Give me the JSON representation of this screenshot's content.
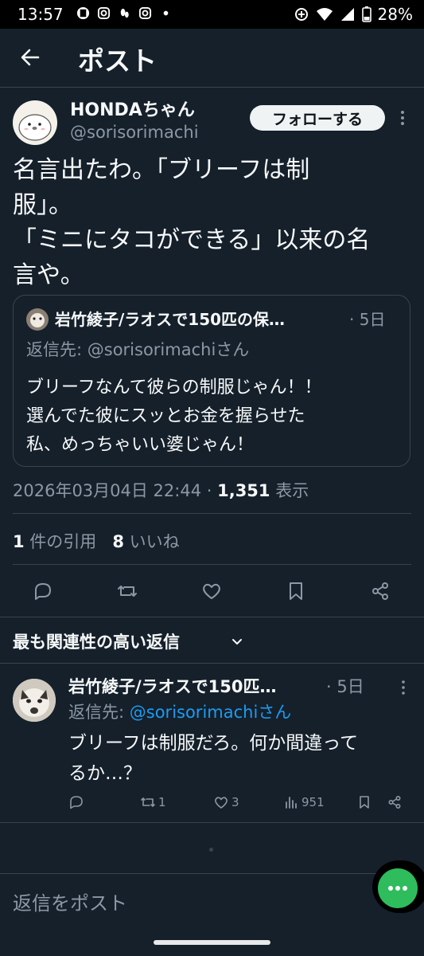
{
  "status_bar": {
    "time": "13:57",
    "battery": "28%"
  },
  "header": {
    "title": "ポスト"
  },
  "main_post": {
    "display_name": "HONDAちゃん",
    "handle": "@sorisorimachi",
    "follow_label": "フォローする",
    "text": "名言出たわ。「ブリーフは制\n服」。\n「ミニにタコができる」以来の名\n言や。",
    "timestamp": "2026年03月04日 22:44 · ",
    "views_count": "1,351",
    "views_label": " 表示",
    "quote_count": "1",
    "quote_label": " 件の引用",
    "like_count": "8",
    "like_label": " いいね"
  },
  "quoted_post": {
    "display_name": "岩竹綾子/ラオスで150匹の保…",
    "time": "· 5日",
    "reply_to": "返信先: @sorisorimachiさん",
    "text": "ブリーフなんて彼らの制服じゃん！！\n選んでた彼にスッとお金を握らせた\n私、めっちゃいい婆じゃん！"
  },
  "replies_section": {
    "sort_label": "最も関連性の高い返信"
  },
  "reply": {
    "display_name": "岩竹綾子/ラオスで150匹…",
    "time": "· 5日",
    "reply_prefix": "返信先: ",
    "reply_handle": "@sorisorimachiさん",
    "text": "ブリーフは制服だろ。何か間違って\nるか…？",
    "retweets": "1",
    "likes": "3",
    "views": "951"
  },
  "composer": {
    "placeholder": "返信をポスト"
  },
  "colors": {
    "background": "#15202b",
    "text": "#f7f9f9",
    "secondary": "#8b98a5",
    "link": "#1d9bf0",
    "border": "#38444d",
    "fab": "#2ebc5d"
  },
  "icons": [
    "back-arrow-icon",
    "more-vertical-icon",
    "reply-icon",
    "retweet-icon",
    "like-icon",
    "bookmark-icon",
    "share-icon",
    "views-icon",
    "chevron-down-icon",
    "more-horizontal-icon"
  ]
}
